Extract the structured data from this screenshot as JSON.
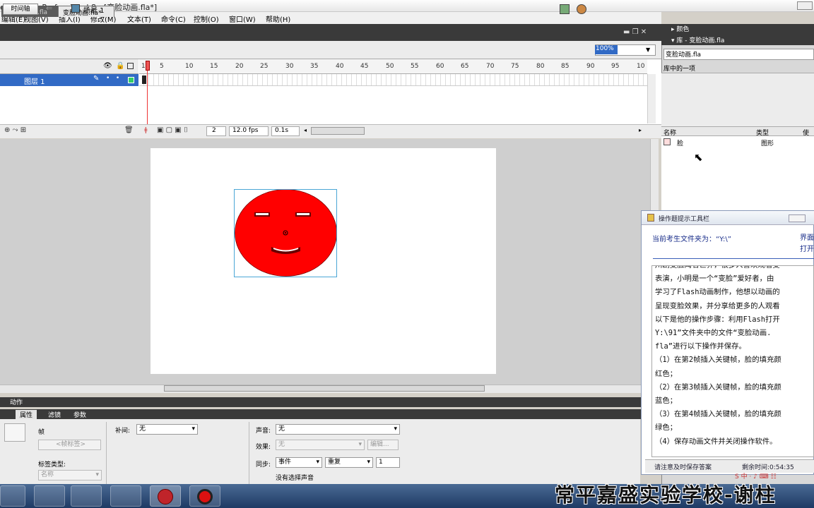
{
  "window": {
    "title": "edia Flash Professional 8 - [变脸动画.fla*]"
  },
  "menu": [
    "编辑(E)",
    "视图(V)",
    "插入(I)",
    "修改(M)",
    "文本(T)",
    "命令(C)",
    "控制(O)",
    "窗口(W)",
    "帮助(H)"
  ],
  "doc_tabs": [
    "跳动的气球.fla",
    "变脸动画.fla*"
  ],
  "editbar": {
    "timeline_btn": "时间轴",
    "scene": "场景 1",
    "zoom": "100%"
  },
  "timeline": {
    "layer_name": "图层 1",
    "ruler": [
      "1",
      "5",
      "10",
      "15",
      "20",
      "25",
      "30",
      "35",
      "40",
      "45",
      "50",
      "55",
      "60",
      "65",
      "70",
      "75",
      "80",
      "85",
      "90",
      "95",
      "10"
    ],
    "current_frame": "2",
    "fps": "12.0 fps",
    "elapsed": "0.1s"
  },
  "panels": {
    "actions": "动作",
    "props_tabs": [
      "属性",
      "滤镜",
      "参数"
    ]
  },
  "properties": {
    "frame_label": "帧",
    "frame_name_placeholder": "<帧标签>",
    "label_type_label": "标签类型:",
    "label_type_value": "名称",
    "tween_label": "补间:",
    "tween_value": "无",
    "sound_label": "声音:",
    "sound_value": "无",
    "effect_label": "效果:",
    "effect_value": "无",
    "edit_btn": "编辑...",
    "sync_label": "同步:",
    "sync_value": "事件",
    "repeat_value": "重复",
    "repeat_count": "1",
    "no_sound": "没有选择声音"
  },
  "library": {
    "color_panel": "颜色",
    "title": "库 - 变脸动画.fla",
    "combo": "变脸动画.fla",
    "count": "库中的一项",
    "columns": [
      "名称",
      "类型",
      "使"
    ],
    "items": [
      {
        "name": "脸",
        "type": "图形"
      }
    ]
  },
  "helper": {
    "title": "操作题提示工具栏",
    "folder": "当前考生文件夹为：“Y:\\”",
    "right_links": [
      "界面",
      "打开"
    ],
    "lines": [
      "川剧变脸闻名世界，很多人喜欢观看变",
      "表演，小明是一个“变脸”爱好者，由",
      "学习了Flash动画制作，他想以动画的",
      "呈现变脸效果，并分享给更多的人观看",
      "以下是他的操作步骤：利用Flash打开",
      "Y:\\91”文件夹中的文件“变脸动画.",
      "fla”进行以下操作并保存。",
      "（1）在第2帧插入关键帧，脸的填充颜",
      "红色；",
      "（2）在第3帧插入关键帧，脸的填充颜",
      "蓝色；",
      "（3）在第4帧插入关键帧，脸的填充颜",
      "绿色；",
      "（4）保存动画文件并关闭操作软件。"
    ],
    "save_hint": "请注意及时保存答案",
    "remaining": "剩余时间:0:54:35"
  },
  "watermark": "常平嘉盛实验学校-谢柱",
  "colors": {
    "face_fill": "#ff0000",
    "selection": "#316ac5"
  }
}
